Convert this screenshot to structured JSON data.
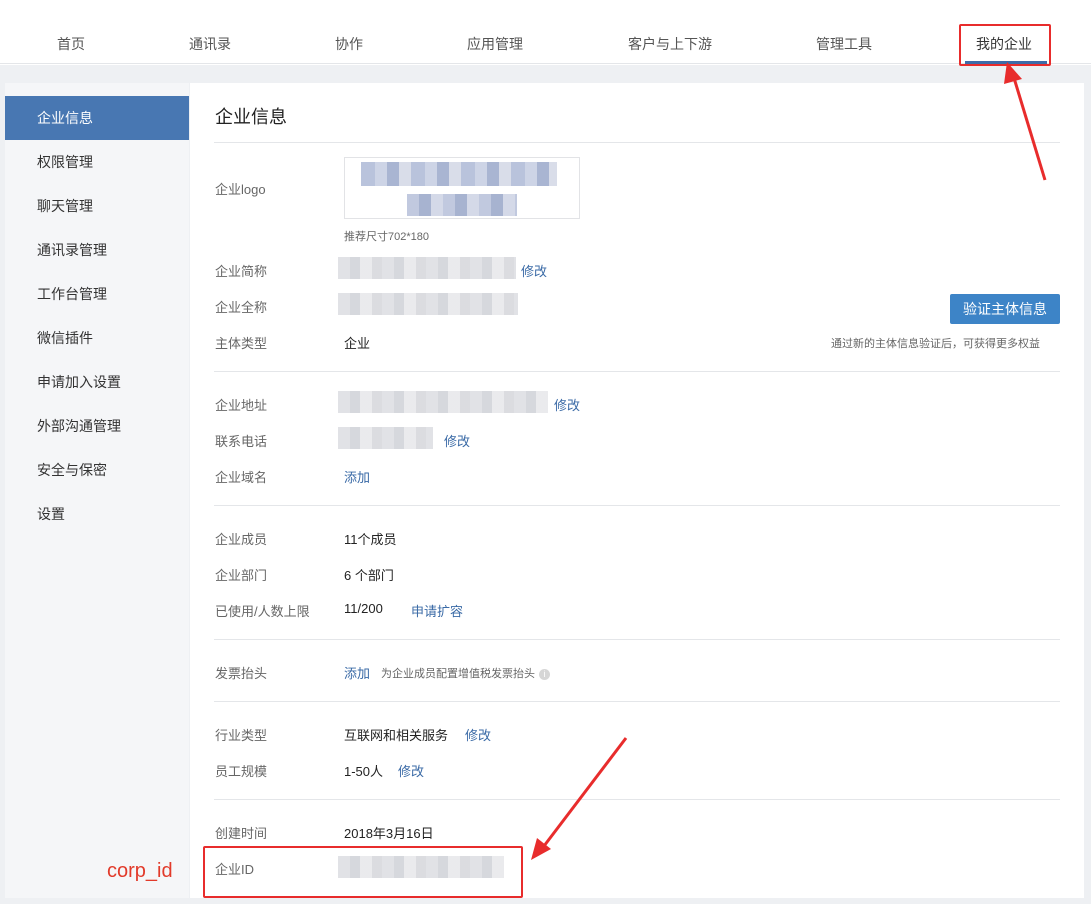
{
  "nav": {
    "items": [
      "首页",
      "通讯录",
      "协作",
      "应用管理",
      "客户与上下游",
      "管理工具",
      "我的企业"
    ],
    "active_index": 6
  },
  "sidebar": {
    "items": [
      "企业信息",
      "权限管理",
      "聊天管理",
      "通讯录管理",
      "工作台管理",
      "微信插件",
      "申请加入设置",
      "外部沟通管理",
      "安全与保密",
      "设置"
    ],
    "active_index": 0
  },
  "main": {
    "title": "企业信息",
    "logo": {
      "label": "企业logo",
      "hint": "推荐尺寸702*180"
    },
    "short_name": {
      "label": "企业简称",
      "action": "修改"
    },
    "full_name": {
      "label": "企业全称"
    },
    "entity_type": {
      "label": "主体类型",
      "value": "企业"
    },
    "verify_button": "验证主体信息",
    "verify_hint": "通过新的主体信息验证后，可获得更多权益",
    "address": {
      "label": "企业地址",
      "action": "修改"
    },
    "phone": {
      "label": "联系电话",
      "action": "修改"
    },
    "domain": {
      "label": "企业域名",
      "action": "添加"
    },
    "members": {
      "label": "企业成员",
      "value": "11个成员"
    },
    "departments": {
      "label": "企业部门",
      "value": "6 个部门"
    },
    "usage": {
      "label": "已使用/人数上限",
      "value": "11/200",
      "action": "申请扩容"
    },
    "invoice": {
      "label": "发票抬头",
      "action": "添加",
      "hint": "为企业成员配置增值税发票抬头"
    },
    "industry": {
      "label": "行业类型",
      "value": "互联网和相关服务",
      "action": "修改"
    },
    "scale": {
      "label": "员工规模",
      "value": "1-50人",
      "action": "修改"
    },
    "created": {
      "label": "创建时间",
      "value": "2018年3月16日"
    },
    "corp_id": {
      "label": "企业ID"
    }
  },
  "annotation": {
    "corp_label": "corp_id",
    "color": "#e82c2c"
  },
  "colors": {
    "accent": "#4877b2",
    "link": "#3a6aa6",
    "button": "#3d84c7"
  }
}
